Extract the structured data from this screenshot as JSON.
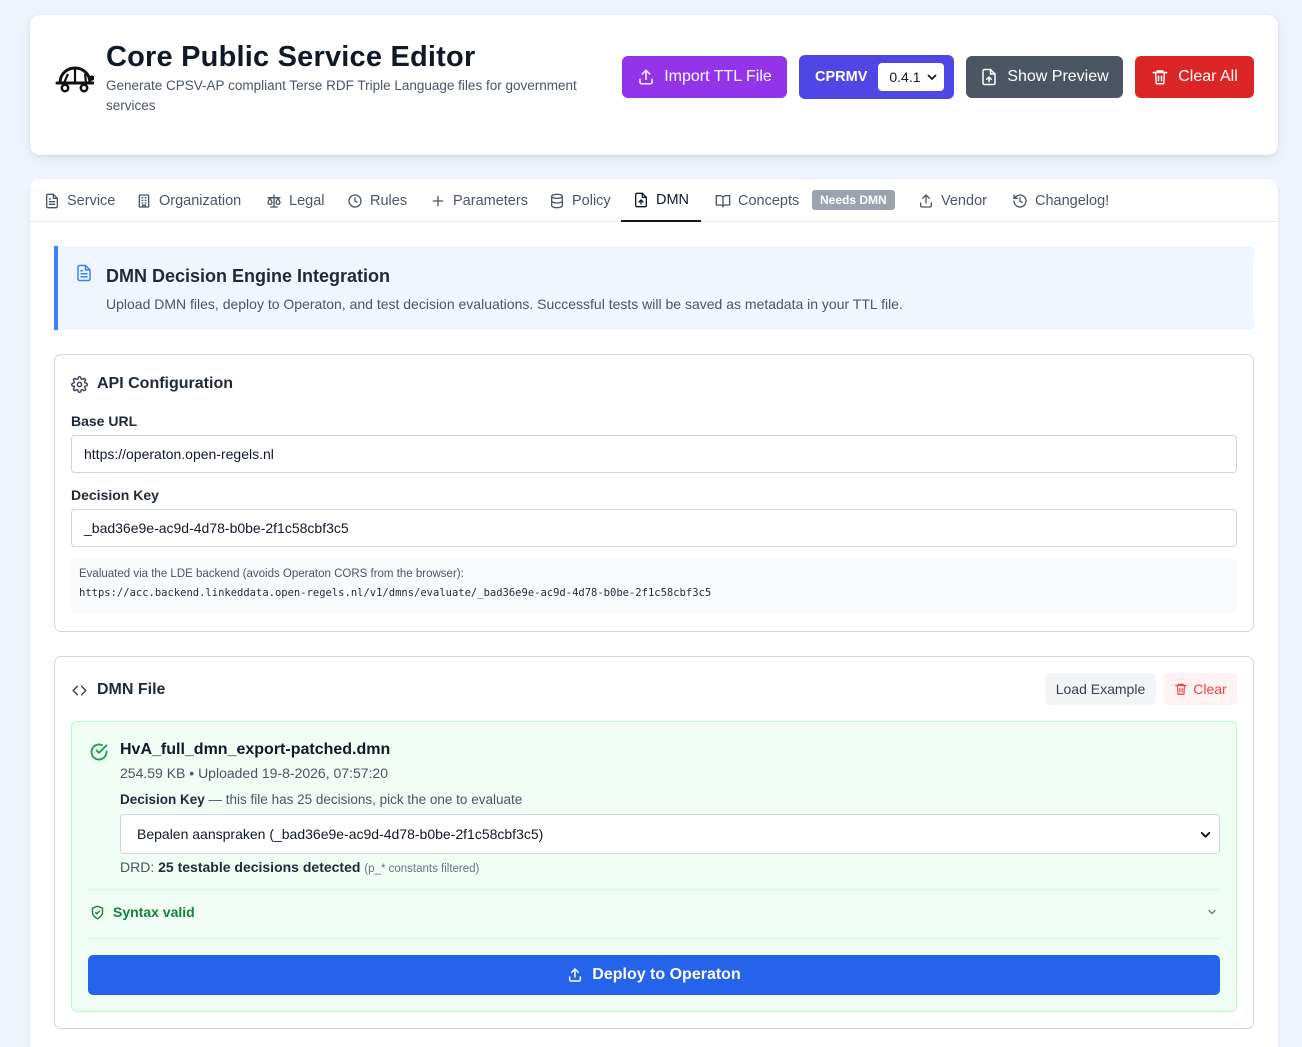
{
  "header": {
    "title": "Core Public Service Editor",
    "subtitle": "Generate CPSV-AP compliant Terse RDF Triple Language files for government services",
    "logo_icon": "turtle-icon",
    "buttons": {
      "import": "Import TTL File",
      "cprmv_label": "CPRMV",
      "cprmv_version": "0.4.1",
      "preview": "Show Preview",
      "clear_all": "Clear All"
    },
    "colors": {
      "import": "#9333ea",
      "cprmv": "#4f46e5",
      "preview": "#4b5563",
      "clear_all": "#dc2626"
    }
  },
  "tabs": [
    {
      "label": "Service",
      "icon": "file-text-icon"
    },
    {
      "label": "Organization",
      "icon": "building-icon"
    },
    {
      "label": "Legal",
      "icon": "scale-icon"
    },
    {
      "label": "Rules",
      "icon": "clock-icon"
    },
    {
      "label": "Parameters",
      "icon": "plus-icon"
    },
    {
      "label": "Policy",
      "icon": "database-icon"
    },
    {
      "label": "DMN",
      "icon": "file-upload-icon",
      "active": true
    },
    {
      "label": "Concepts",
      "icon": "book-open-icon",
      "badge": "Needs DMN"
    },
    {
      "label": "Vendor",
      "icon": "upload-icon"
    },
    {
      "label": "Changelog!",
      "icon": "history-icon"
    }
  ],
  "banner": {
    "title": "DMN Decision Engine Integration",
    "text": "Upload DMN files, deploy to Operaton, and test decision evaluations. Successful tests will be saved as metadata in your TTL file."
  },
  "api_config": {
    "title": "API Configuration",
    "base_url_label": "Base URL",
    "base_url_value": "https://operaton.open-regels.nl",
    "decision_key_label": "Decision Key",
    "decision_key_value": "_bad36e9e-ac9d-4d78-b0be-2f1c58cbf3c5",
    "endpoint_note": "Evaluated via the LDE backend (avoids Operaton CORS from the browser):",
    "endpoint_url": "https://acc.backend.linkeddata.open-regels.nl/v1/dmns/evaluate/_bad36e9e-ac9d-4d78-b0be-2f1c58cbf3c5"
  },
  "dmn_file": {
    "title": "DMN File",
    "load_example": "Load Example",
    "clear": "Clear",
    "file_name": "HvA_full_dmn_export-patched.dmn",
    "file_meta": "254.59 KB • Uploaded 19-8-2026, 07:57:20",
    "decision_key_label": "Decision Key",
    "decision_key_hint": " — this file has 25 decisions, pick the one to evaluate",
    "decision_key_selected": "Bepalen aanspraken (_bad36e9e-ac9d-4d78-b0be-2f1c58cbf3c5)",
    "drd_prefix": "DRD: ",
    "drd_bold": "25 testable decisions detected",
    "drd_note": "(p_* constants filtered)",
    "syntax_status": "Syntax valid",
    "deploy_button": "Deploy to Operaton",
    "colors": {
      "success": "#15803d",
      "deploy": "#2563eb"
    }
  }
}
